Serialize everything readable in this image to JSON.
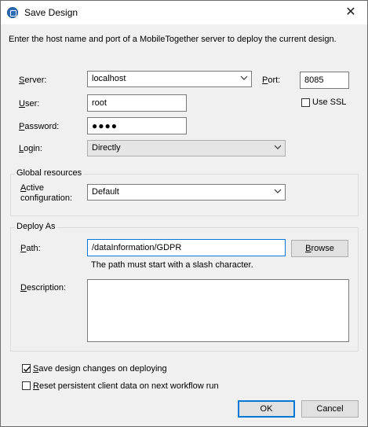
{
  "window": {
    "title": "Save Design",
    "close_glyph": "✕",
    "icon": "mobiletogether-app-icon"
  },
  "intro_text": "Enter the host name and port of a MobileTogether server to deploy the current design.",
  "server": {
    "label_accel": "S",
    "label_rest": "erver:",
    "value": "localhost",
    "port_label_accel": "P",
    "port_label_rest": "ort:",
    "port_value": "8085",
    "use_ssl_label": "Use SSL",
    "use_ssl_checked": false
  },
  "user": {
    "label_accel": "U",
    "label_rest": "ser:",
    "value": "root"
  },
  "password": {
    "label_accel": "P",
    "label_rest": "assword:",
    "masked": "●●●●"
  },
  "login": {
    "label_accel": "L",
    "label_rest": "ogin:",
    "value": "Directly"
  },
  "global_resources": {
    "title": "Global resources",
    "active_label_accel": "A",
    "active_label_rest": "ctive",
    "active_label_line2": "configuration:",
    "value": "Default"
  },
  "deploy_as": {
    "title": "Deploy As",
    "path_label_accel": "P",
    "path_label_rest": "ath:",
    "path_value": "/dataInformation/GDPR",
    "browse_accel": "B",
    "browse_rest": "rowse",
    "path_hint": "The path must start with a slash character.",
    "description_label_accel": "D",
    "description_label_rest": "escription:",
    "description_value": ""
  },
  "options": {
    "save_changes_accel": "S",
    "save_changes_rest": "ave design changes on deploying",
    "save_changes_checked": true,
    "reset_data_accel": "R",
    "reset_data_rest": "eset persistent client data on next workflow run",
    "reset_data_checked": false
  },
  "buttons": {
    "ok": "OK",
    "cancel": "Cancel"
  },
  "colors": {
    "accent": "#0078d7",
    "dialog_bg": "#f0f0f0"
  }
}
